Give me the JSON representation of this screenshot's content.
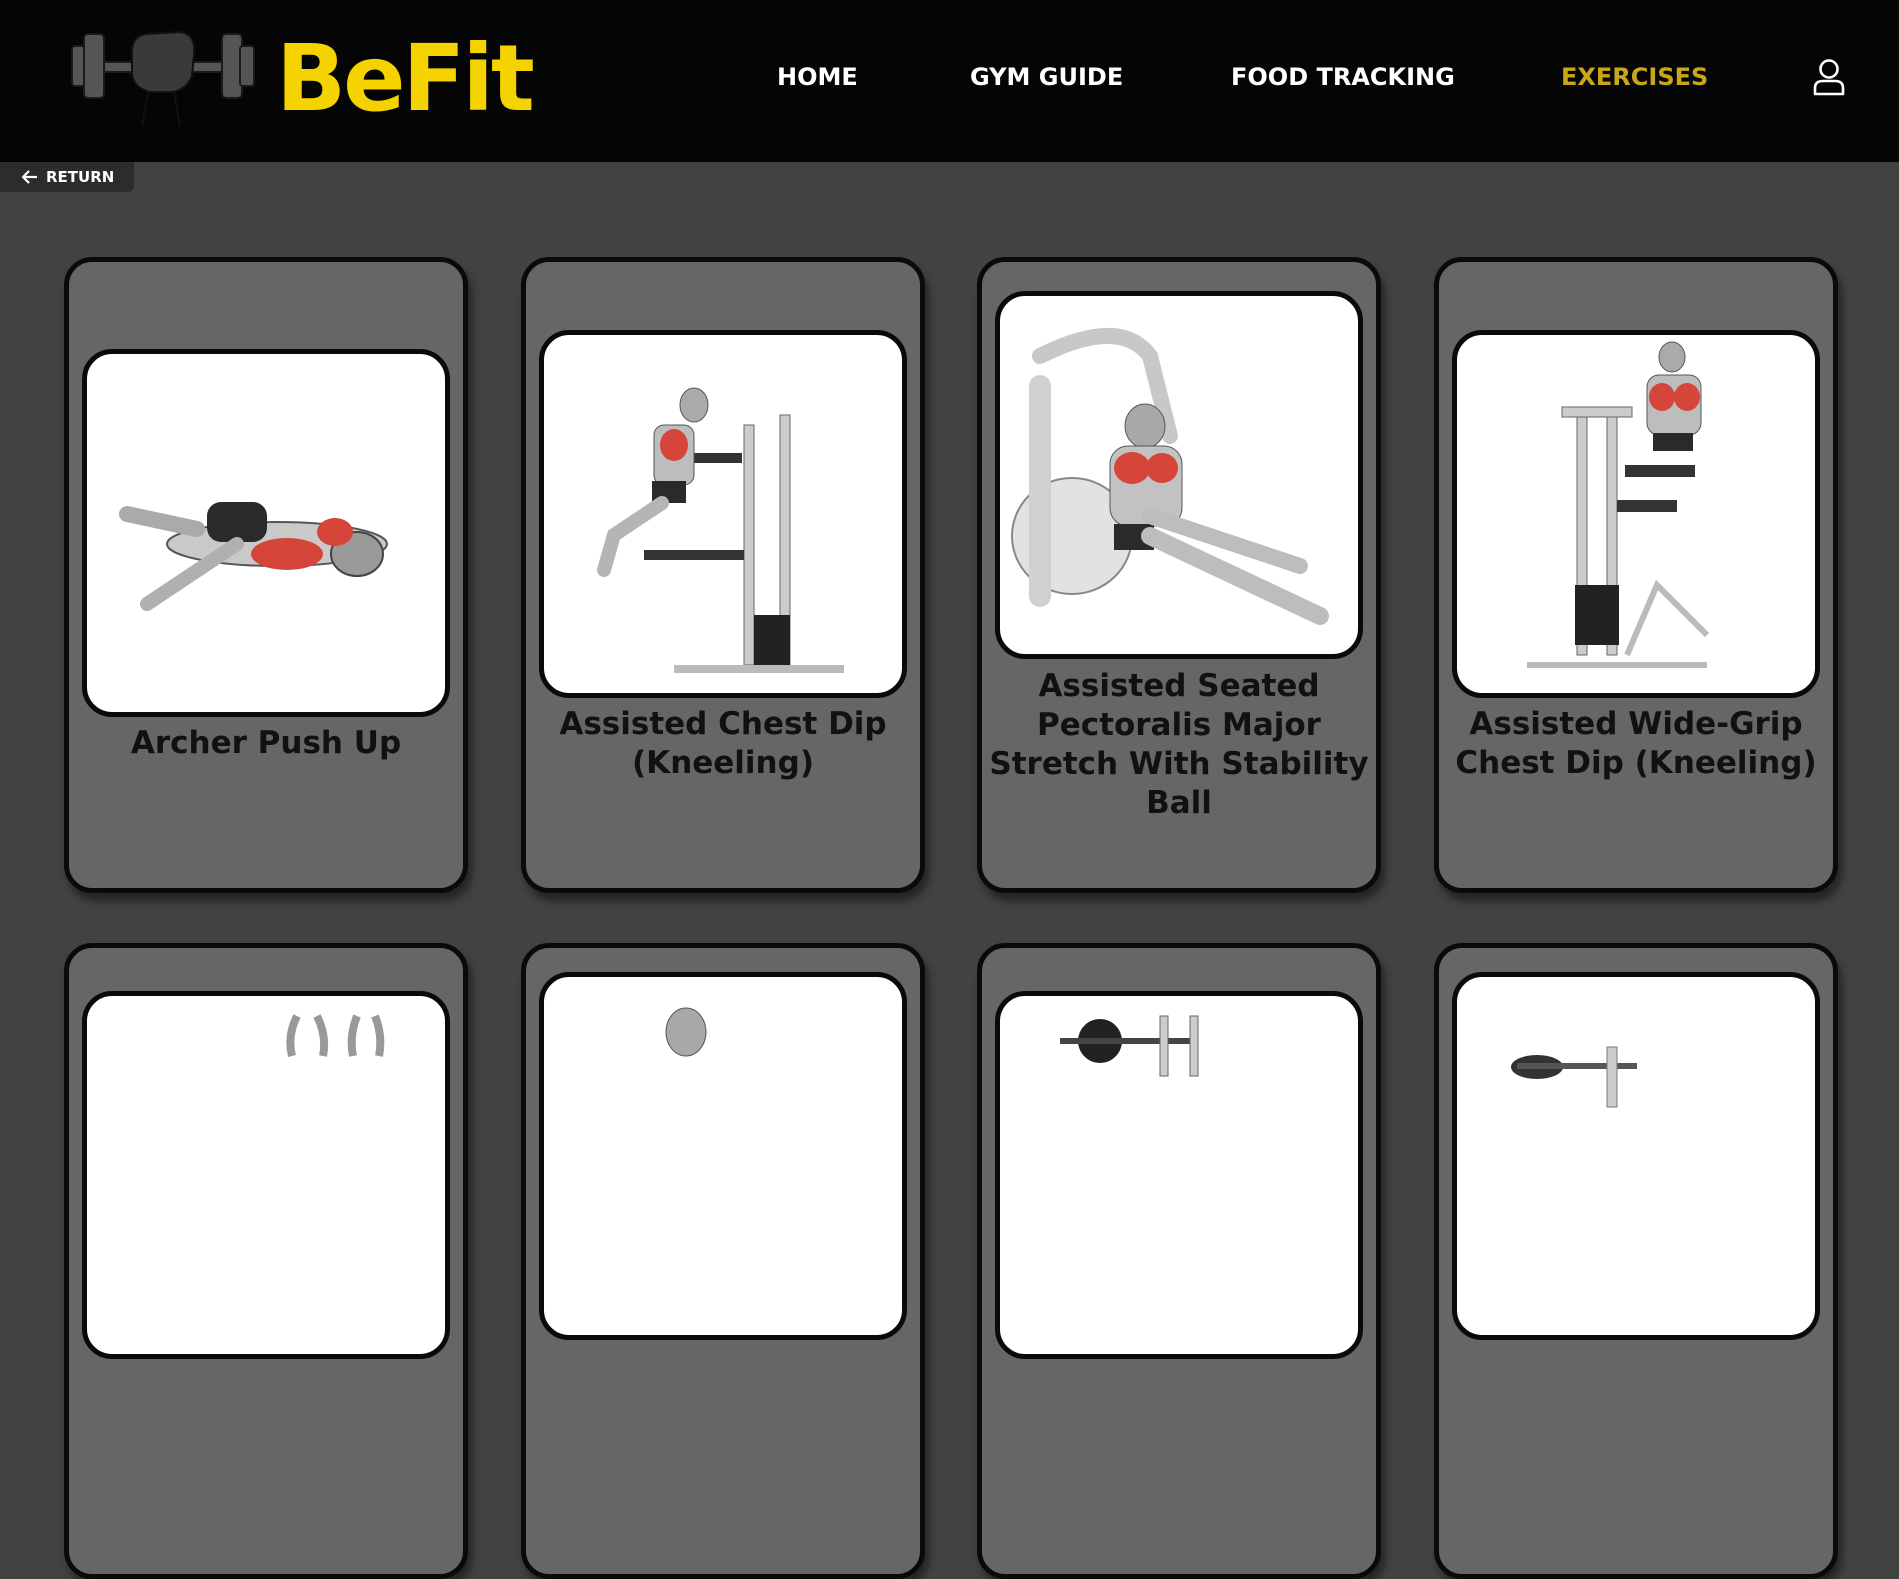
{
  "header": {
    "brand": "BeFit",
    "logo_icon": "dumbbell-fist-logo",
    "brand_color": "#f5d300",
    "nav": [
      {
        "label": "HOME",
        "active": false
      },
      {
        "label": "GYM GUIDE",
        "active": false
      },
      {
        "label": "FOOD TRACKING",
        "active": false
      },
      {
        "label": "EXERCISES",
        "active": true
      }
    ],
    "active_color": "#c9a718",
    "user_icon": "user-icon"
  },
  "return_button": {
    "label": "RETURN",
    "icon": "arrow-left-icon"
  },
  "exercises": [
    {
      "title": "Archer Push Up"
    },
    {
      "title": "Assisted Chest Dip (Kneeling)"
    },
    {
      "title": "Assisted Seated Pectoralis Major Stretch With Stability Ball"
    },
    {
      "title": "Assisted Wide-Grip Chest Dip (Kneeling)"
    },
    {
      "title": ""
    },
    {
      "title": ""
    },
    {
      "title": ""
    },
    {
      "title": ""
    }
  ],
  "colors": {
    "page_bg": "#424242",
    "card_bg": "#666666",
    "card_border": "#0a0a0a",
    "muscle_highlight": "#d6453a"
  }
}
